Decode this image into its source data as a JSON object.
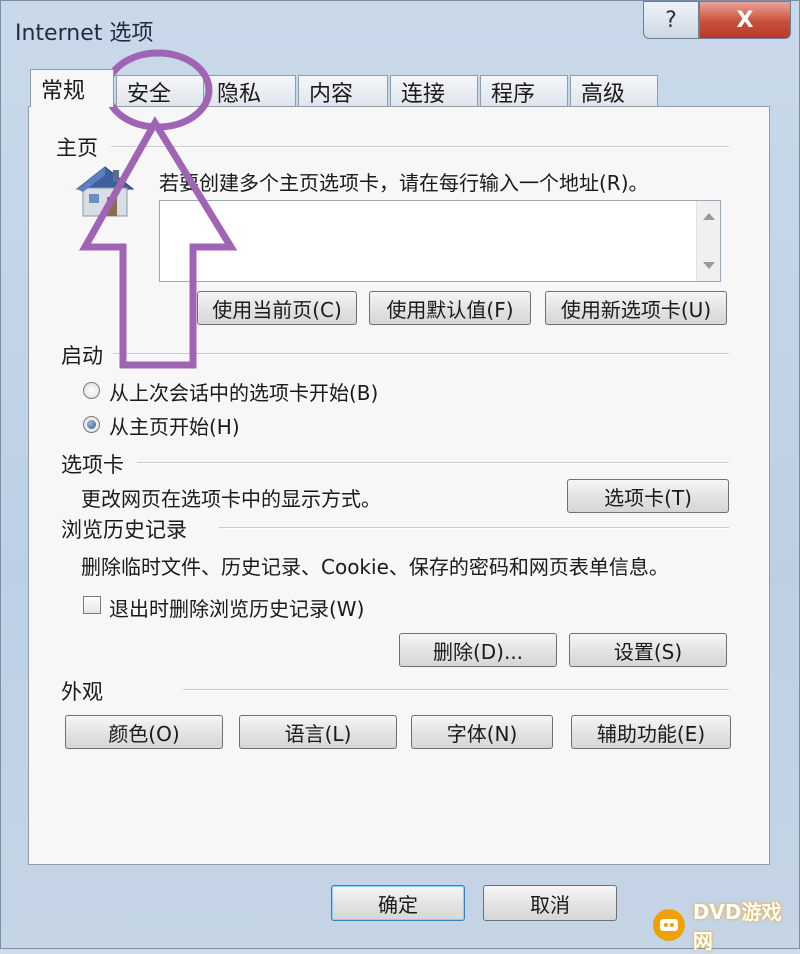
{
  "window": {
    "title": "Internet 选项",
    "help_label": "?",
    "close_label": "X"
  },
  "tabs": [
    {
      "label": "常规"
    },
    {
      "label": "安全"
    },
    {
      "label": "隐私"
    },
    {
      "label": "内容"
    },
    {
      "label": "连接"
    },
    {
      "label": "程序"
    },
    {
      "label": "高级"
    }
  ],
  "home": {
    "section_title": "主页",
    "instruction": "若要创建多个主页选项卡，请在每行输入一个地址(R)。",
    "address_value": "",
    "buttons": {
      "use_current": "使用当前页(C)",
      "use_default": "使用默认值(F)",
      "use_new_tab": "使用新选项卡(U)"
    }
  },
  "startup": {
    "section_title": "启动",
    "options": [
      {
        "label": "从上次会话中的选项卡开始(B)",
        "checked": false
      },
      {
        "label": "从主页开始(H)",
        "checked": true
      }
    ]
  },
  "tabs_section": {
    "section_title": "选项卡",
    "description": "更改网页在选项卡中的显示方式。",
    "button": "选项卡(T)"
  },
  "history": {
    "section_title": "浏览历史记录",
    "description": "删除临时文件、历史记录、Cookie、保存的密码和网页表单信息。",
    "checkbox_label": "退出时删除浏览历史记录(W)",
    "checkbox_checked": false,
    "delete_button": "删除(D)...",
    "settings_button": "设置(S)"
  },
  "appearance": {
    "section_title": "外观",
    "buttons": {
      "colors": "颜色(O)",
      "languages": "语言(L)",
      "fonts": "字体(N)",
      "accessibility": "辅助功能(E)"
    }
  },
  "footer": {
    "ok": "确定",
    "cancel": "取消"
  },
  "watermark": {
    "text": "DVD游戏网"
  },
  "colors": {
    "annotation": "#a064b4",
    "close_button": "#c9503a",
    "default_button_border": "#3c7fb1"
  },
  "icons": {
    "home": "house-icon"
  }
}
